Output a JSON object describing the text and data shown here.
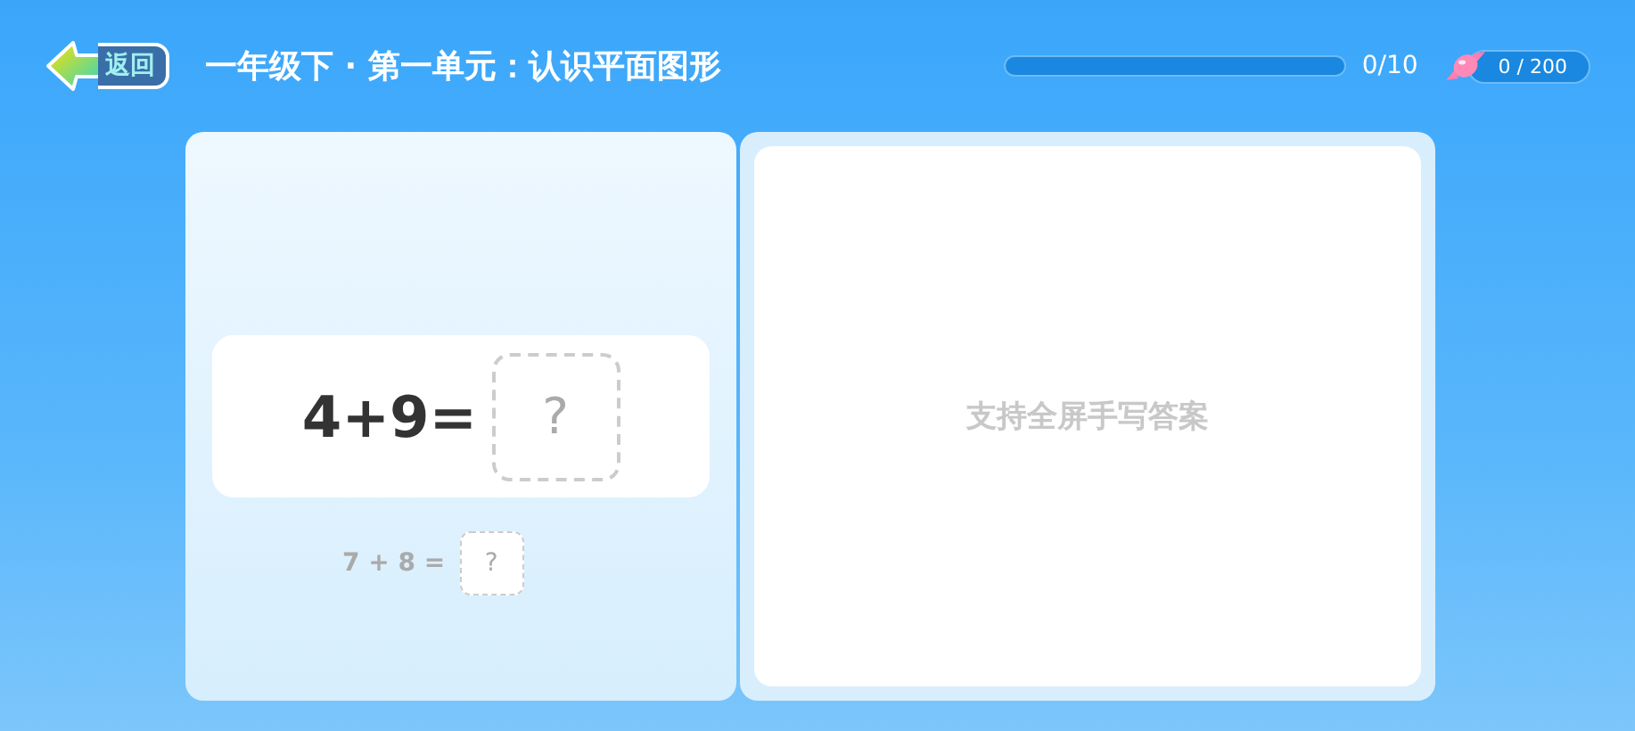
{
  "header": {
    "back_label": "返回",
    "title": "一年级下 · 第一单元：认识平面图形",
    "progress": {
      "level": 0,
      "reading": "0/10"
    },
    "candy": {
      "reading": "0 / 200"
    }
  },
  "questions": [
    {
      "expression": "4+9=",
      "placeholder": "?",
      "current": true
    },
    {
      "expression": "7 + 8 =",
      "placeholder": "?",
      "current": false
    }
  ],
  "handwriting": {
    "placeholder": "支持全屏手写答案"
  }
}
